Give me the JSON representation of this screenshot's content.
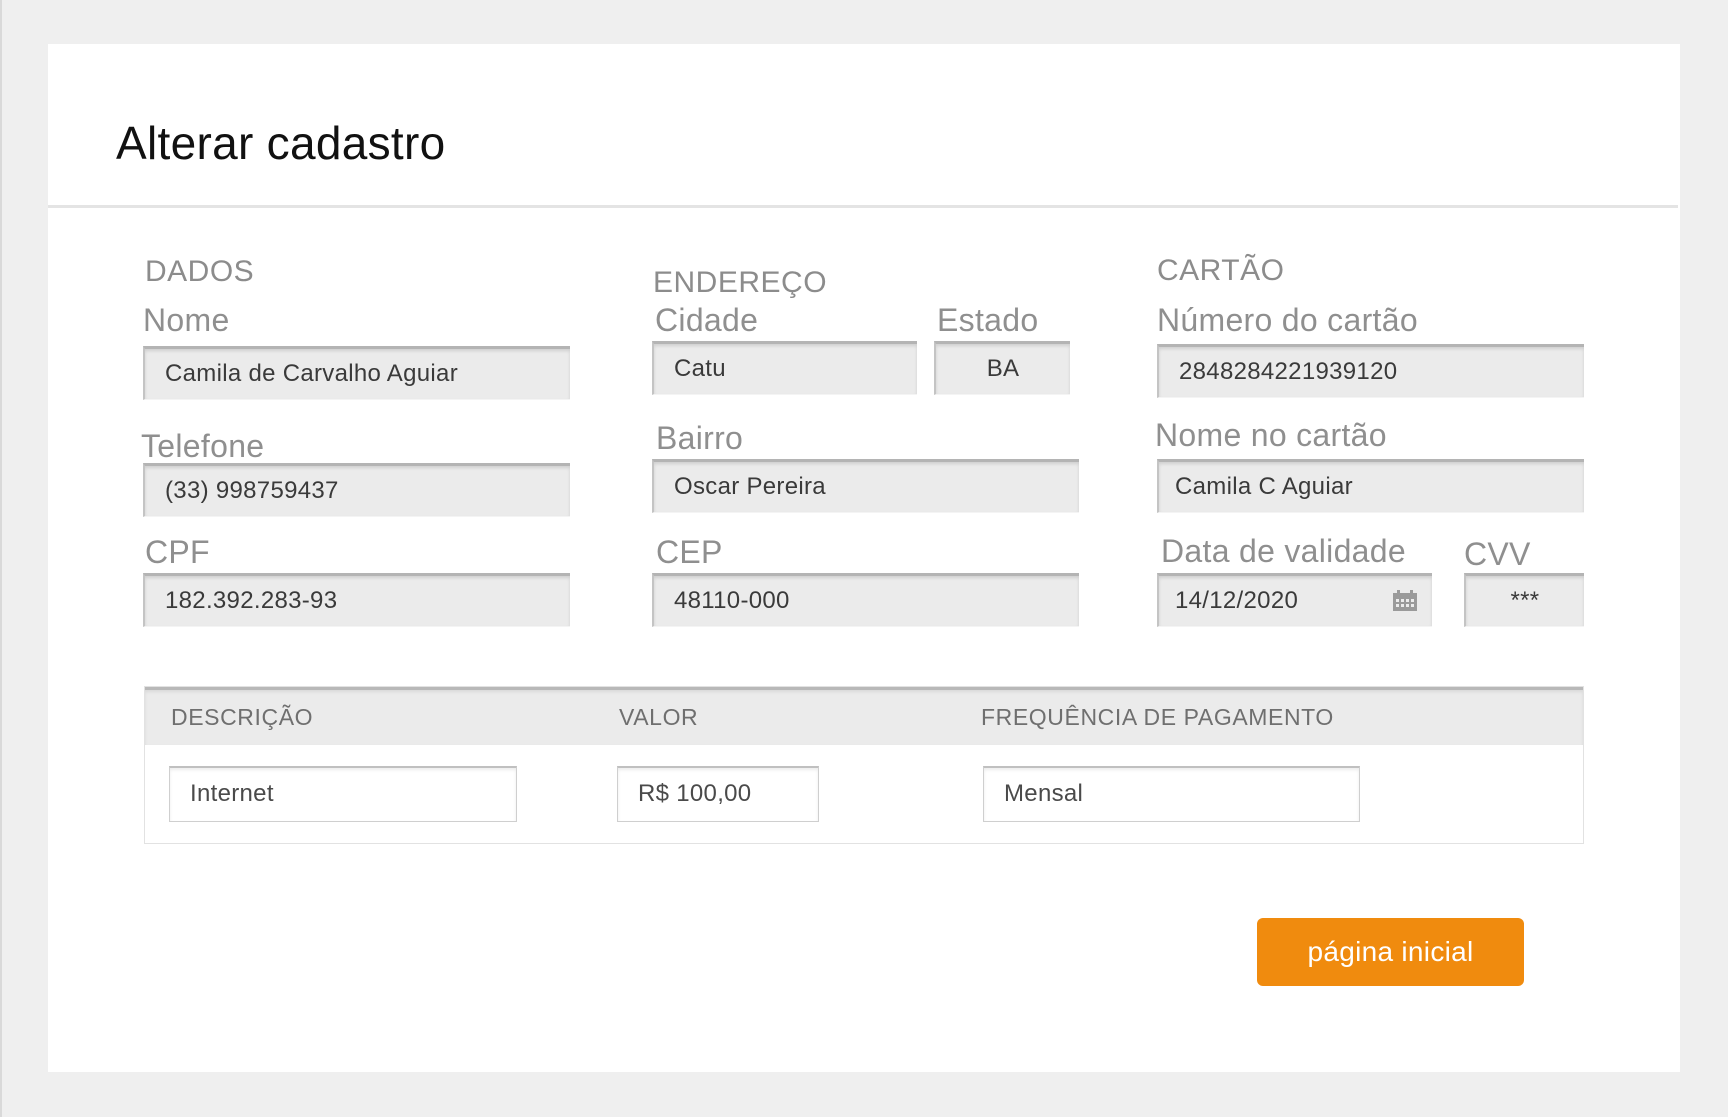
{
  "page": {
    "title": "Alterar cadastro"
  },
  "dados": {
    "section_label": "DADOS",
    "nome_label": "Nome",
    "nome_value": "Camila de Carvalho Aguiar",
    "telefone_label": "Telefone",
    "telefone_value": "(33) 998759437",
    "cpf_label": "CPF",
    "cpf_value": "182.392.283-93"
  },
  "endereco": {
    "section_label": "ENDEREÇO",
    "cidade_label": "Cidade",
    "cidade_value": "Catu",
    "estado_label": "Estado",
    "estado_value": "BA",
    "bairro_label": "Bairro",
    "bairro_value": "Oscar Pereira",
    "cep_label": "CEP",
    "cep_value": "48110-000"
  },
  "cartao": {
    "section_label": "CARTÃO",
    "numero_label": "Número do cartão",
    "numero_value": "2848284221939120",
    "nome_label": "Nome no cartão",
    "nome_value": "Camila C Aguiar",
    "validade_label": "Data de validade",
    "validade_value": "14/12/2020",
    "validade_icon": "calendar-icon",
    "cvv_label": "CVV",
    "cvv_value": "***"
  },
  "servicos": {
    "headers": {
      "descricao": "DESCRIÇÃO",
      "valor": "VALOR",
      "frequencia": "FREQUÊNCIA DE PAGAMENTO"
    },
    "row": {
      "descricao": "Internet",
      "valor": "R$ 100,00",
      "frequencia": "Mensal"
    }
  },
  "actions": {
    "home_label": "página inicial",
    "home_color": "#f08b0e"
  }
}
